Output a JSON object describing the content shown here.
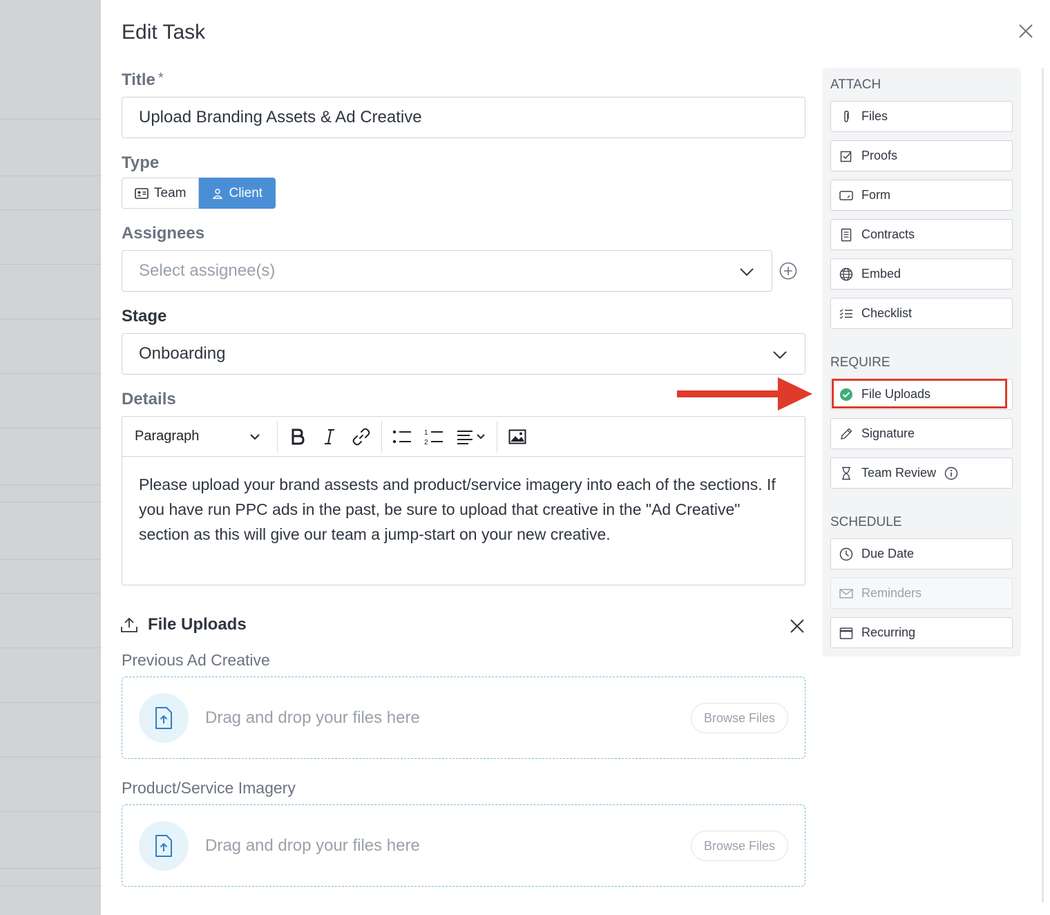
{
  "header": {
    "title": "Edit Task"
  },
  "form": {
    "title_label": "Title",
    "title_required": "*",
    "title_value": "Upload Branding Assets & Ad Creative",
    "type_label": "Type",
    "type_options": [
      {
        "label": "Team",
        "selected": false
      },
      {
        "label": "Client",
        "selected": true
      }
    ],
    "assignees_label": "Assignees",
    "assignees_placeholder": "Select assignee(s)",
    "stage_label": "Stage",
    "stage_value": "Onboarding",
    "details_label": "Details",
    "editor": {
      "block_format": "Paragraph",
      "body": "Please upload your brand assests and product/service imagery into each of the sections. If you have run PPC ads in the past, be sure to upload that creative in the \"Ad Creative\" section as this will give our team a jump-start on your new creative."
    }
  },
  "file_uploads": {
    "title": "File Uploads",
    "sections": [
      {
        "label": "Previous Ad Creative",
        "drop_text": "Drag and drop your files here",
        "browse_label": "Browse Files"
      },
      {
        "label": "Product/Service Imagery",
        "drop_text": "Drag and drop your files here",
        "browse_label": "Browse Files"
      }
    ]
  },
  "sidebar": {
    "attach_heading": "ATTACH",
    "attach_items": [
      {
        "label": "Files",
        "icon": "paperclip-icon"
      },
      {
        "label": "Proofs",
        "icon": "checkbox-icon"
      },
      {
        "label": "Form",
        "icon": "form-icon"
      },
      {
        "label": "Contracts",
        "icon": "document-icon"
      },
      {
        "label": "Embed",
        "icon": "globe-icon"
      },
      {
        "label": "Checklist",
        "icon": "checklist-icon"
      }
    ],
    "require_heading": "REQUIRE",
    "require_items": [
      {
        "label": "File Uploads",
        "icon": "check-circle-icon",
        "active": true
      },
      {
        "label": "Signature",
        "icon": "pen-icon"
      },
      {
        "label": "Team Review",
        "icon": "hourglass-icon"
      }
    ],
    "schedule_heading": "SCHEDULE",
    "schedule_items": [
      {
        "label": "Due Date",
        "icon": "clock-icon"
      },
      {
        "label": "Reminders",
        "icon": "envelope-icon",
        "disabled": true
      },
      {
        "label": "Recurring",
        "icon": "calendar-icon"
      }
    ]
  },
  "colors": {
    "accent": "#4a8fd6",
    "annotation": "#e03a2a",
    "success": "#3fae7a"
  }
}
